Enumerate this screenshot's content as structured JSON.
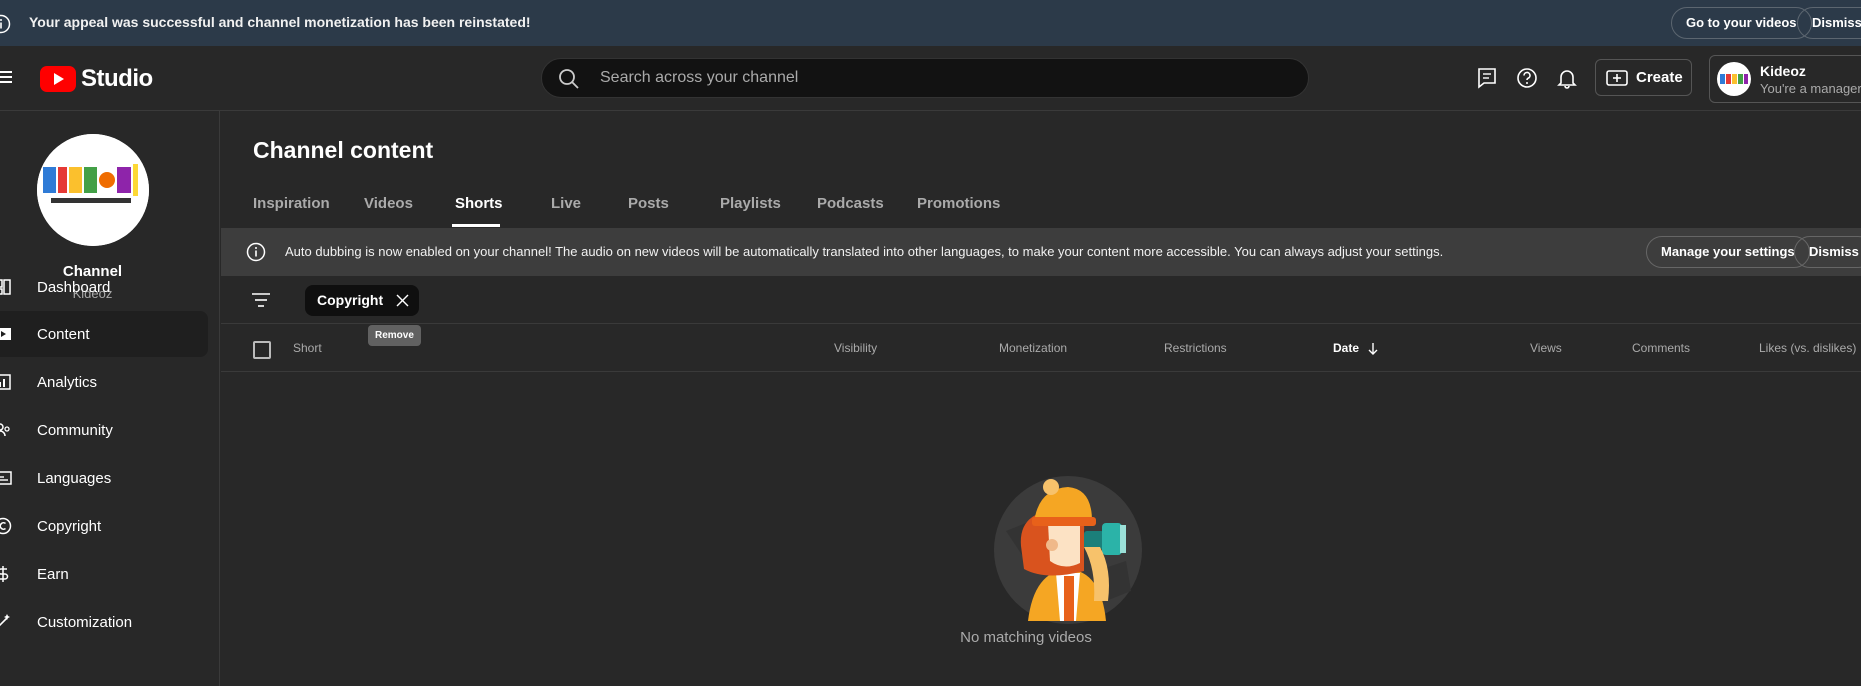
{
  "top_banner": {
    "message": "Your appeal was successful and channel monetization has been reinstated!",
    "go_to_videos_label": "Go to your videos",
    "dismiss_label": "Dismiss"
  },
  "header": {
    "studio_label": "Studio",
    "search_placeholder": "Search across your channel",
    "create_label": "Create",
    "account_name": "Kideoz",
    "account_role": "You're a manager"
  },
  "sidebar": {
    "channel_label": "Channel",
    "channel_name": "Kideoz",
    "items": [
      {
        "label": "Dashboard",
        "icon": "dashboard-icon"
      },
      {
        "label": "Content",
        "icon": "content-icon"
      },
      {
        "label": "Analytics",
        "icon": "analytics-icon"
      },
      {
        "label": "Community",
        "icon": "community-icon"
      },
      {
        "label": "Languages",
        "icon": "languages-icon"
      },
      {
        "label": "Copyright",
        "icon": "copyright-icon"
      },
      {
        "label": "Earn",
        "icon": "earn-icon"
      },
      {
        "label": "Customization",
        "icon": "customization-icon"
      }
    ]
  },
  "main": {
    "title": "Channel content",
    "tabs": [
      {
        "label": "Inspiration"
      },
      {
        "label": "Videos"
      },
      {
        "label": "Shorts"
      },
      {
        "label": "Live"
      },
      {
        "label": "Posts"
      },
      {
        "label": "Playlists"
      },
      {
        "label": "Podcasts"
      },
      {
        "label": "Promotions"
      }
    ],
    "active_tab": "Shorts",
    "dub_banner": {
      "message": "Auto dubbing is now enabled on your channel! The audio on new videos will be automatically translated into other languages, to make your content more accessible. You can always adjust your settings.",
      "manage_label": "Manage your settings",
      "dismiss_label": "Dismiss"
    },
    "filter_chip": "Copyright",
    "tooltip": "Remove",
    "columns": {
      "short": "Short",
      "visibility": "Visibility",
      "monetization": "Monetization",
      "restrictions": "Restrictions",
      "date": "Date",
      "views": "Views",
      "comments": "Comments",
      "likes": "Likes (vs. dislikes)"
    },
    "empty_text": "No matching videos"
  },
  "colors": {
    "brand_red": "#ff0000",
    "banner_bg": "#2c3a49",
    "background": "#282828"
  }
}
